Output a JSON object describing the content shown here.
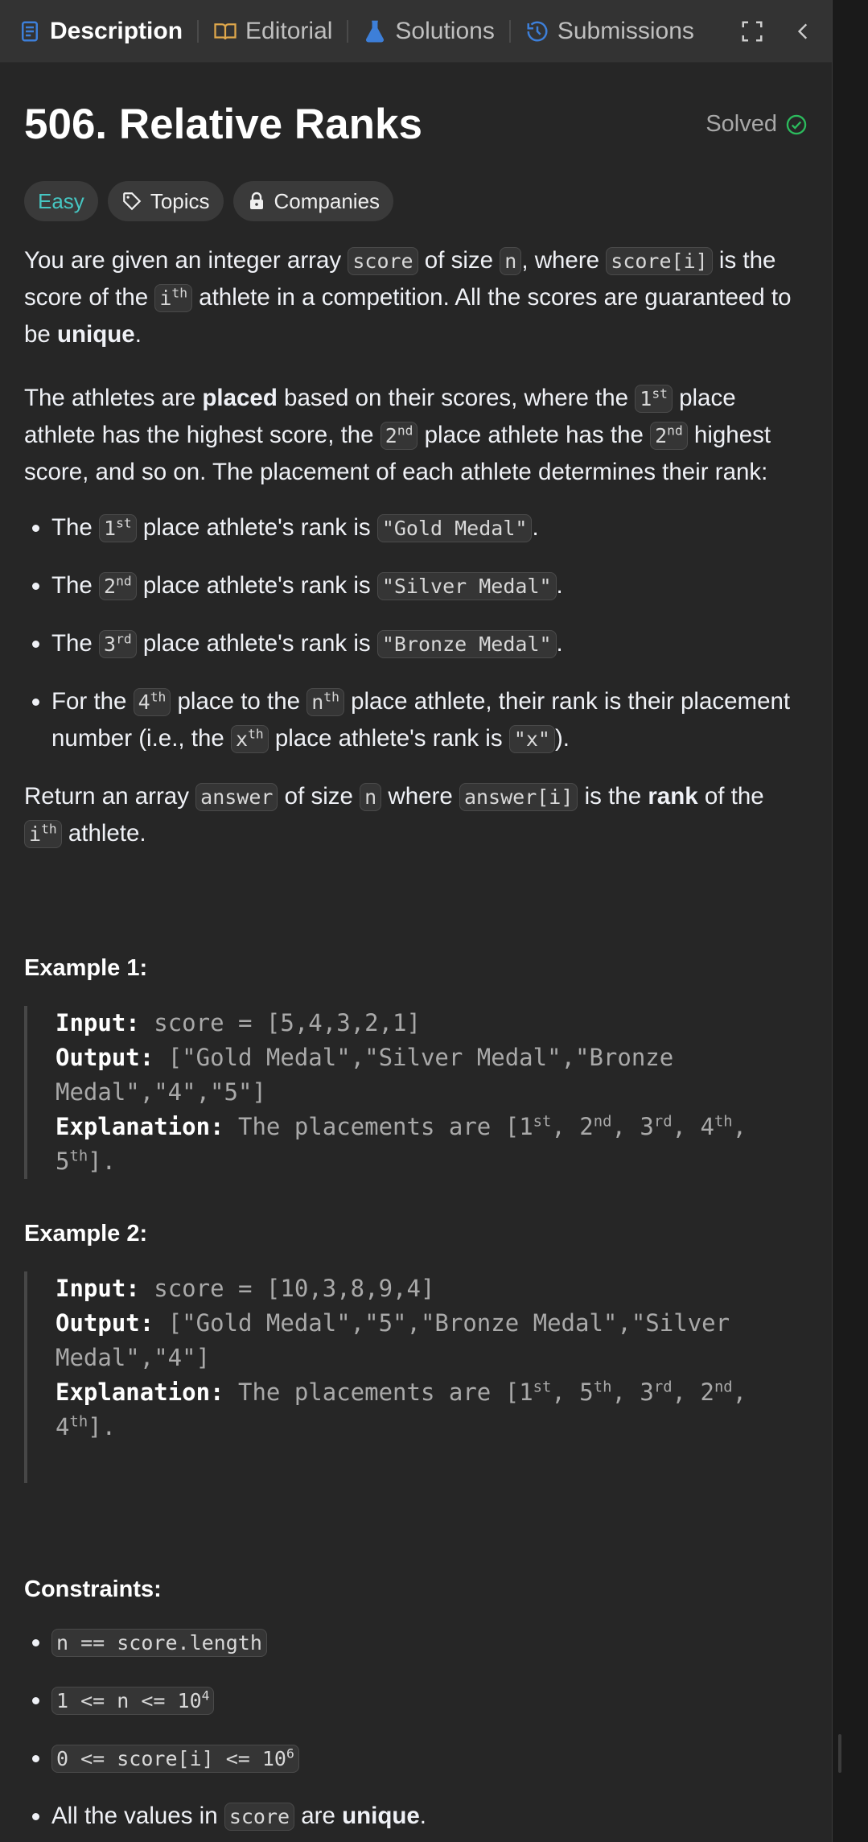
{
  "tabs": [
    {
      "label": "Description",
      "icon": "description-icon",
      "active": true
    },
    {
      "label": "Editorial",
      "icon": "book-icon"
    },
    {
      "label": "Solutions",
      "icon": "flask-icon"
    },
    {
      "label": "Submissions",
      "icon": "history-icon"
    }
  ],
  "problem": {
    "title": "506. Relative Ranks",
    "status": "Solved",
    "difficulty": "Easy",
    "topics_label": "Topics",
    "companies_label": "Companies"
  },
  "desc": {
    "p1": {
      "t1": "You are given an integer array ",
      "c1": "score",
      "t2": " of size ",
      "c2": "n",
      "t3": ", where ",
      "c3": "score[i]",
      "t4": " is the score of the ",
      "c4": "i",
      "c4s": "th",
      "t5": " athlete in a competition. All the scores are guaranteed to be ",
      "b1": "unique",
      "t6": "."
    },
    "p2": {
      "t1": "The athletes are ",
      "b1": "placed",
      "t2": " based on their scores, where the ",
      "c1": "1",
      "c1s": "st",
      "t3": " place athlete has the highest score, the ",
      "c2": "2",
      "c2s": "nd",
      "t4": " place athlete has the ",
      "c3": "2",
      "c3s": "nd",
      "t5": " highest score, and so on. The placement of each athlete determines their rank:"
    },
    "bullets": [
      {
        "t1": "The ",
        "c1": "1",
        "c1s": "st",
        "t2": " place athlete's rank is ",
        "c2": "\"Gold Medal\"",
        "t3": "."
      },
      {
        "t1": "The ",
        "c1": "2",
        "c1s": "nd",
        "t2": " place athlete's rank is ",
        "c2": "\"Silver Medal\"",
        "t3": "."
      },
      {
        "t1": "The ",
        "c1": "3",
        "c1s": "rd",
        "t2": " place athlete's rank is ",
        "c2": "\"Bronze Medal\"",
        "t3": "."
      }
    ],
    "bullet4": {
      "t1": "For the ",
      "c1": "4",
      "c1s": "th",
      "t2": " place to the ",
      "c2": "n",
      "c2s": "th",
      "t3": " place athlete, their rank is their placement number (i.e., the ",
      "c3": "x",
      "c3s": "th",
      "t4": " place athlete's rank is ",
      "c4": "\"x\"",
      "t5": ")."
    },
    "ret": {
      "t1": "Return an array ",
      "c1": "answer",
      "t2": " of size ",
      "c2": "n",
      "t3": " where ",
      "c3": "answer[i]",
      "t4": " is the ",
      "b1": "rank",
      "t5": " of the ",
      "c4": "i",
      "c4s": "th",
      "t6": " athlete."
    }
  },
  "examples": [
    {
      "heading": "Example 1:",
      "input_label": "Input:",
      "input": "score = [5,4,3,2,1]",
      "output_label": "Output:",
      "output": "[\"Gold Medal\",\"Silver Medal\",\"Bronze Medal\",\"4\",\"5\"]",
      "exp_label": "Explanation:",
      "exp_pre": "The placements are [",
      "p": [
        [
          "1",
          "st"
        ],
        [
          "2",
          "nd"
        ],
        [
          "3",
          "rd"
        ],
        [
          "4",
          "th"
        ],
        [
          "5",
          "th"
        ]
      ],
      "exp_post": "]."
    },
    {
      "heading": "Example 2:",
      "input_label": "Input:",
      "input": "score = [10,3,8,9,4]",
      "output_label": "Output:",
      "output": "[\"Gold Medal\",\"5\",\"Bronze Medal\",\"Silver Medal\",\"4\"]",
      "exp_label": "Explanation:",
      "exp_pre": "The placements are [",
      "p": [
        [
          "1",
          "st"
        ],
        [
          "5",
          "th"
        ],
        [
          "3",
          "rd"
        ],
        [
          "2",
          "nd"
        ],
        [
          "4",
          "th"
        ]
      ],
      "exp_post": "]."
    }
  ],
  "constraints": {
    "heading": "Constraints:",
    "c1": "n == score.length",
    "c2": "1 <= n <= 10",
    "c2s": "4",
    "c3": "0 <= score[i] <= 10",
    "c3s": "6",
    "c4t1": "All the values in ",
    "c4c": "score",
    "c4t2": " are ",
    "c4b": "unique",
    "c4t3": "."
  },
  "colors": {
    "accent": "#2cbb5d",
    "easy": "#46c6c2",
    "tab_icon_blue": "#3d7fd9"
  }
}
